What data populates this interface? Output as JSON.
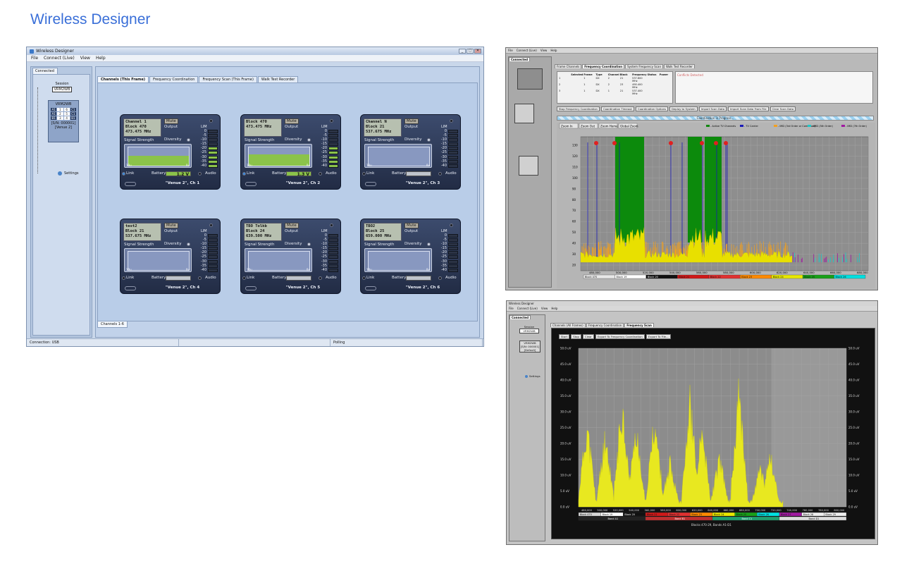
{
  "page_title": "Wireless Designer",
  "main_window": {
    "title": "Wireless Designer",
    "menu": [
      "File",
      "Connect (Live)",
      "View",
      "Help"
    ],
    "side_tab": "Connected",
    "session_label": "Session",
    "session_device": "VRM2WB",
    "device": {
      "name": "VRM2WB",
      "slots": [
        "A1",
        "1",
        "6",
        "C1",
        "A1",
        "2",
        "5",
        "C1",
        "B1",
        "3",
        "4",
        "B1"
      ],
      "serial": "[S/N: 000001]",
      "venue": "[Venue 2]"
    },
    "settings_label": "Settings",
    "tabs": [
      "Channels (This Frame)",
      "Frequency Coordination",
      "Frequency Scan (This Frame)",
      "Walk Test Recorder"
    ],
    "subtab": "Channels 1-6",
    "status": [
      "Connection: USB",
      "",
      "Polling"
    ],
    "card_labels": {
      "mute": "Mute",
      "output": "Output",
      "signal": "Signal Strength",
      "diversity": "Diversity",
      "lim": "LIM",
      "audio": "Audio",
      "link": "Link",
      "battery": "Battery",
      "ax_left": "10u",
      "ax_right": "0u"
    },
    "meter_scale": [
      "0",
      "-5",
      "-10",
      "-15",
      "-20",
      "-25",
      "-30",
      "-35",
      "-40"
    ],
    "channels": [
      {
        "line1": "Channel 1",
        "line2": "Block 470",
        "freq": "473.475 MHz",
        "battery": "1.2 V",
        "level": 0.55,
        "meter_on": 5,
        "footer": "\"Venue 2\", Ch 1"
      },
      {
        "line1": "Block 470",
        "line2": "",
        "freq": "473.475 MHz",
        "battery": "1.3 V",
        "level": 0.6,
        "meter_on": 5,
        "footer": "\"Venue 2\", Ch 2"
      },
      {
        "line1": "Channel N",
        "line2": "Block 21",
        "freq": "537.675 MHz",
        "battery": "",
        "level": 0,
        "meter_on": 0,
        "footer": "\"Venue 2\", Ch 3"
      },
      {
        "line1": "test2",
        "line2": "Block 21",
        "freq": "537.675 MHz",
        "battery": "",
        "level": 0,
        "meter_on": 0,
        "footer": "\"Venue 2\", Ch 4"
      },
      {
        "line1": "TBO Tolkb",
        "line2": "Block 24",
        "freq": "639.500 MHz",
        "battery": "",
        "level": 0,
        "meter_on": 0,
        "footer": "\"Venue 2\", Ch 5"
      },
      {
        "line1": "TBO2",
        "line2": "Block 25",
        "freq": "659.000 MHz",
        "battery": "",
        "level": 0,
        "meter_on": 0,
        "footer": "\"Venue 2\", Ch 6"
      }
    ]
  },
  "coordination_window": {
    "menu": [
      "File",
      "Connect (Live)",
      "View",
      "Help"
    ],
    "side_tab": "Connected",
    "tabs": [
      "Frame Channels",
      "Frequency Coordination",
      "System Frequency Scan",
      "Walk Test Recorder"
    ],
    "table_headers": [
      "Selected",
      "Frame",
      "Type",
      "Channel",
      "Block",
      "Frequency",
      "Status",
      "Power"
    ],
    "table_rows": [
      [
        "1",
        "",
        "1",
        "DX",
        "2",
        "21",
        "537.600 MHz",
        "",
        ""
      ],
      [
        "2",
        "",
        "1",
        "DX",
        "2",
        "23",
        "490.400 MHz",
        "",
        ""
      ],
      [
        "3",
        "",
        "1",
        "DX",
        "1",
        "21",
        "537.400 MHz",
        "",
        ""
      ]
    ],
    "conflict_title": "Conflicts Detected",
    "buttons": [
      "Stop Frequency Coordination",
      "Coordination Timeout",
      "Coordination Options",
      "Deploy to System",
      "Import Scan Data",
      "Import Scan Data From File",
      "Clear Scan Data"
    ],
    "progress_label": "Coordination in Progress...",
    "chart_buttons": [
      "Zoom In",
      "Zoom Out",
      "Zoom Home",
      "Global Zoom"
    ],
    "legend": [
      {
        "label": "- Active TV Channels",
        "color": "#118811"
      },
      {
        "label": "- TV Carrier",
        "color": "#1a1ab8"
      },
      {
        "label": "- IMD (3rd Order or Combined)",
        "color": "#f2a020"
      },
      {
        "label": "- IMD (5th Order)",
        "color": "#1ec8c8"
      },
      {
        "label": "- IMD (7th Order)",
        "color": "#a01aa0"
      }
    ],
    "y_ticks": [
      "130",
      "120",
      "110",
      "100",
      "90",
      "80",
      "70",
      "60",
      "50",
      "40",
      "30",
      "20"
    ],
    "x_ticks": [
      "480,000",
      "500,000",
      "520,000",
      "540,000",
      "560,000",
      "580,000",
      "600,000",
      "620,000",
      "640,000",
      "660,000",
      "680,000"
    ],
    "blocks": [
      {
        "label": "Block 470",
        "color": "#e8e8e8"
      },
      {
        "label": "Block 19",
        "color": "#ffffff"
      },
      {
        "label": "Block 20",
        "color": "#111111"
      },
      {
        "label": "Block 21",
        "color": "#d01818"
      },
      {
        "label": "Block 22",
        "color": "#e03030"
      },
      {
        "label": "Block 23",
        "color": "#ff8a00"
      },
      {
        "label": "Block 24",
        "color": "#e8e800"
      },
      {
        "label": "Block 25",
        "color": "#18a018"
      },
      {
        "label": "Block 26",
        "color": "#00e0e0"
      }
    ]
  },
  "scan_window": {
    "title": "Wireless Designer",
    "menu": [
      "File",
      "Connect (Live)",
      "View",
      "Help"
    ],
    "side_tab": "Connected",
    "session_label": "Session",
    "session_device": "VRM2WB",
    "device_name": "VRM2WB",
    "serial": "[S/N: 000001]",
    "venue": "[Default]",
    "settings_label": "Settings",
    "tabs": [
      "Channels (All Frames)",
      "Frequency Coordination",
      "Frequency Scan"
    ],
    "buttons": [
      "Start",
      "Stop",
      "Clear",
      "Export To Frequency Coordination",
      "Export To File..."
    ],
    "y_ticks": [
      "50.0 uV",
      "45.0 uV",
      "40.0 uV",
      "35.0 uV",
      "30.0 uV",
      "25.0 uV",
      "20.0 uV",
      "15.0 uV",
      "10.0 uV",
      "5.0 uV",
      "0.0 uV"
    ],
    "x_ticks": [
      "480,000",
      "500,000",
      "520,000",
      "540,000",
      "560,000",
      "580,000",
      "600,000",
      "620,000",
      "640,000",
      "660,000",
      "680,000",
      "700,000",
      "720,000",
      "740,000",
      "760,000",
      "780,000",
      "800,000"
    ],
    "blocks": [
      "Block 470",
      "Block 19",
      "Block 20",
      "Block 21",
      "Block 22",
      "Block 23",
      "Block 24",
      "Block 25",
      "Block 26",
      "Block 27",
      "Block 28",
      "Block 29"
    ],
    "bands": [
      "Band A1",
      "Band B1",
      "Band C1",
      "Band D1"
    ],
    "footer": "Blocks 470-29, Bands A1-D1"
  }
}
